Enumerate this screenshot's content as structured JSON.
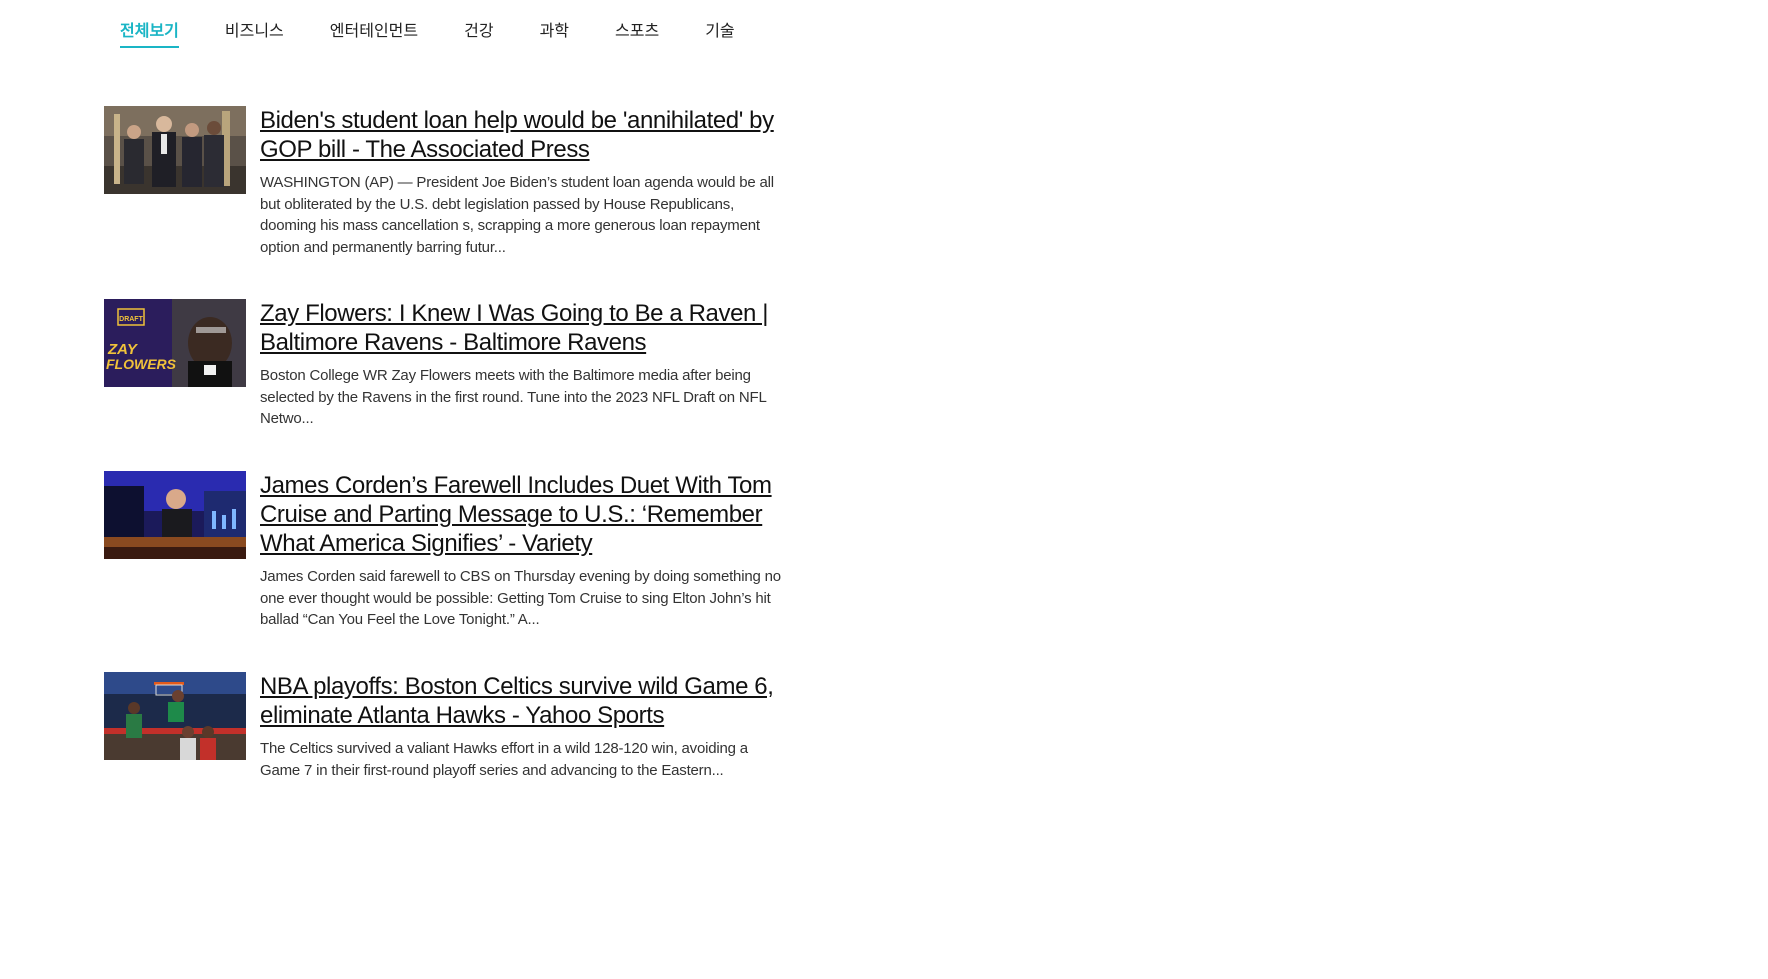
{
  "tabs": [
    {
      "label": "전체보기",
      "active": true
    },
    {
      "label": "비즈니스",
      "active": false
    },
    {
      "label": "엔터테인먼트",
      "active": false
    },
    {
      "label": "건강",
      "active": false
    },
    {
      "label": "과학",
      "active": false
    },
    {
      "label": "스포츠",
      "active": false
    },
    {
      "label": "기술",
      "active": false
    }
  ],
  "accent_color": "#1ab5c5",
  "articles": [
    {
      "headline": "Biden's student loan help would be 'annihilated' by GOP bill - The Associated Press",
      "summary": "WASHINGTON (AP) — President Joe Biden’s student loan agenda would be all but obliterated by the U.S. debt legislation passed by House Republicans, dooming his mass cancellation s, scrapping a more generous loan repayment option and permanently barring futur..."
    },
    {
      "headline": "Zay Flowers: I Knew I Was Going to Be a Raven | Baltimore Ravens - Baltimore Ravens",
      "summary": "Boston College WR Zay Flowers meets with the Baltimore media after being selected by the Ravens in the first round. Tune into the 2023 NFL Draft on NFL Netwo...",
      "thumb_text": {
        "badge": "DRAFT",
        "name_line1": "ZAY",
        "name_line2": "FLOWERS"
      }
    },
    {
      "headline": "James Corden’s Farewell Includes Duet With Tom Cruise and Parting Message to U.S.: ‘Remember What America Signifies’ - Variety",
      "summary": "James Corden said farewell to CBS on Thursday evening by doing something no one ever thought would be possible: Getting Tom Cruise to sing Elton John’s hit ballad “Can You Feel the Love Tonight.” A..."
    },
    {
      "headline": "NBA playoffs: Boston Celtics survive wild Game 6, eliminate Atlanta Hawks - Yahoo Sports",
      "summary": "The Celtics survived a valiant Hawks effort in a wild 128-120 win, avoiding a Game 7 in their first-round playoff series and advancing to the Eastern..."
    }
  ]
}
